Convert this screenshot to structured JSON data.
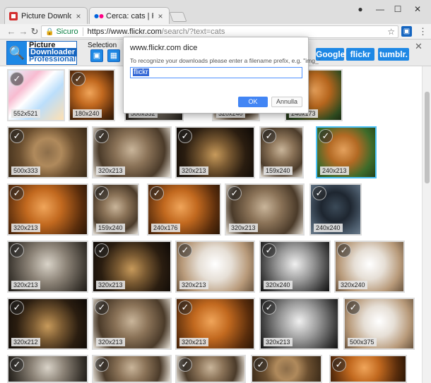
{
  "browser": {
    "tabs": [
      {
        "title": "Picture Downloader Profe",
        "favicon_color": "#d32f2f"
      },
      {
        "title": "Cerca: cats | Flickr",
        "favicon_color": "#0063dc"
      }
    ],
    "close_glyph": "×",
    "window_controls": {
      "user": "●",
      "minimize": "—",
      "maximize": "☐",
      "close": "✕"
    },
    "nav": {
      "back": "←",
      "forward": "→",
      "reload": "↻"
    },
    "omnibox": {
      "lock": "🔒",
      "secure_label": "Sicuro",
      "url_host": "https://www.flickr.com",
      "url_path": "/search/?text=cats",
      "star": "☆"
    },
    "menu_glyph": "⋮"
  },
  "extension_bar": {
    "logo": {
      "line1": "Picture",
      "line2": "Downloader",
      "line3": "Professional",
      "glyph": "🔍"
    },
    "selection_label": "Selection",
    "selection_buttons": [
      "▣",
      "▦"
    ],
    "services": [
      "Google",
      "flickr",
      "tumblr."
    ],
    "close_glyph": "✕"
  },
  "dialog": {
    "title": "www.flickr.com dice",
    "message": "To recognize your downloads please enter a filename prefix, e.g. \"img_\"",
    "input_value": "flickr",
    "ok_label": "OK",
    "cancel_label": "Annulla"
  },
  "gallery": {
    "check_glyph": "✓",
    "tiles": [
      {
        "dims": "552x521",
        "photo": "collage"
      },
      {
        "dims": "180x240",
        "photo": "orange"
      },
      {
        "dims": "500x332",
        "photo": "grey"
      },
      {
        "dims": "320x240",
        "photo": "tabby"
      },
      {
        "dims": "240x173",
        "photo": "ginger"
      },
      {
        "dims": "500x333",
        "photo": "closeup"
      },
      {
        "dims": "320x213",
        "photo": "tabby"
      },
      {
        "dims": "320x213",
        "photo": "dark"
      },
      {
        "dims": "159x240",
        "photo": "tabby"
      },
      {
        "dims": "240x213",
        "photo": "ginger-green"
      },
      {
        "dims": "320x213",
        "photo": "orange"
      },
      {
        "dims": "159x240",
        "photo": "tabby"
      },
      {
        "dims": "240x176",
        "photo": "orange"
      },
      {
        "dims": "320x213",
        "photo": "tabby"
      },
      {
        "dims": "240x240",
        "photo": "black"
      },
      {
        "dims": "320x213",
        "photo": "grey"
      },
      {
        "dims": "320x213",
        "photo": "dark"
      },
      {
        "dims": "320x213",
        "photo": "white"
      },
      {
        "dims": "320x240",
        "photo": "bw"
      },
      {
        "dims": "320x240",
        "photo": "white"
      },
      {
        "dims": "320x212",
        "photo": "dark"
      },
      {
        "dims": "320x213",
        "photo": "tabby"
      },
      {
        "dims": "320x213",
        "photo": "orange"
      },
      {
        "dims": "320x213",
        "photo": "bw"
      },
      {
        "dims": "500x375",
        "photo": "white"
      },
      {
        "dims": "",
        "photo": "grey"
      },
      {
        "dims": "",
        "photo": "tabby"
      },
      {
        "dims": "",
        "photo": "tabby"
      },
      {
        "dims": "",
        "photo": "closeup"
      },
      {
        "dims": "",
        "photo": "orange"
      }
    ]
  }
}
